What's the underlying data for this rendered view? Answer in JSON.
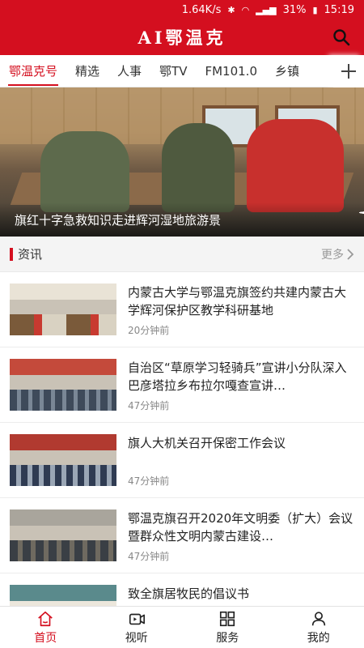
{
  "status": {
    "speed": "1.64K/s",
    "battery": "31%",
    "time": "15:19"
  },
  "app": {
    "title": "AI鄂温克"
  },
  "tabs": [
    "鄂温克号",
    "精选",
    "人事",
    "鄂TV",
    "FM101.0",
    "乡镇"
  ],
  "active_tab": 0,
  "banner": {
    "caption": "旗红十字急救知识走进辉河湿地旅游景",
    "dot_count": 7,
    "active_dot": 0
  },
  "section": {
    "title": "资讯",
    "more": "更多"
  },
  "news": [
    {
      "title": "内蒙古大学与鄂温克旗签约共建内蒙古大学辉河保护区教学科研基地",
      "time": "20分钟前"
    },
    {
      "title": "自治区“草原学习轻骑兵”宣讲小分队深入巴彦塔拉乡布拉尔嘎查宣讲…",
      "time": "47分钟前"
    },
    {
      "title": "旗人大机关召开保密工作会议",
      "time": "47分钟前"
    },
    {
      "title": "鄂温克旗召开2020年文明委（扩大）会议暨群众性文明内蒙古建设…",
      "time": "47分钟前"
    },
    {
      "title": "致全旗居牧民的倡议书",
      "time": ""
    }
  ],
  "bottom_nav": [
    {
      "label": "首页",
      "icon": "home-icon"
    },
    {
      "label": "视听",
      "icon": "video-icon"
    },
    {
      "label": "服务",
      "icon": "grid-icon"
    },
    {
      "label": "我的",
      "icon": "user-icon"
    }
  ],
  "colors": {
    "brand": "#d40f1f"
  }
}
